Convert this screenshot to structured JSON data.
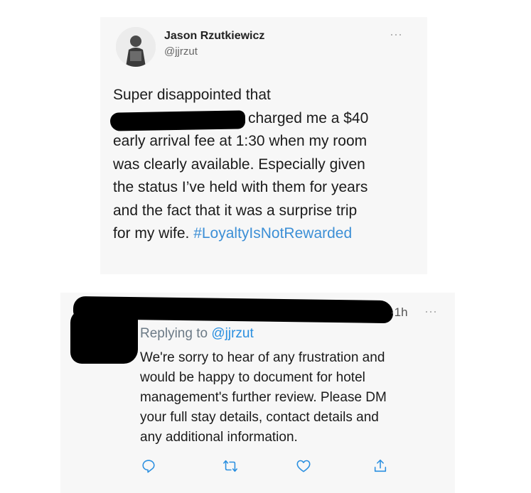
{
  "tweet": {
    "author_name": "Jason Rzutkiewicz",
    "author_handle": "@jjrzut",
    "more_label": "···",
    "lines": [
      "Super disappointed that",
      "charged me a $40",
      "early arrival fee at 1:30 when my room",
      "was clearly available. Especially given",
      "the status I’ve held with them for years",
      "and the fact that it was a surprise trip"
    ],
    "last_line_text": "for my wife.",
    "hashtag": "#LoyaltyIsNotRewarded"
  },
  "reply": {
    "time": "·1h",
    "more_label": "···",
    "replying_prefix": "Replying to",
    "replying_handle": "@jjrzut",
    "lines": [
      "We're sorry to hear of any frustration and",
      "would be happy to document for hotel",
      "management's further review. Please DM",
      "your full stay details, contact details and",
      "any additional information."
    ],
    "actions": [
      "reply-icon",
      "retweet-icon",
      "like-icon",
      "share-icon"
    ]
  },
  "colors": {
    "link": "#2a8fe0",
    "hashtag": "#3c8fd6",
    "card_background": "#f7f7f7",
    "icon": "#2a8fe0"
  }
}
